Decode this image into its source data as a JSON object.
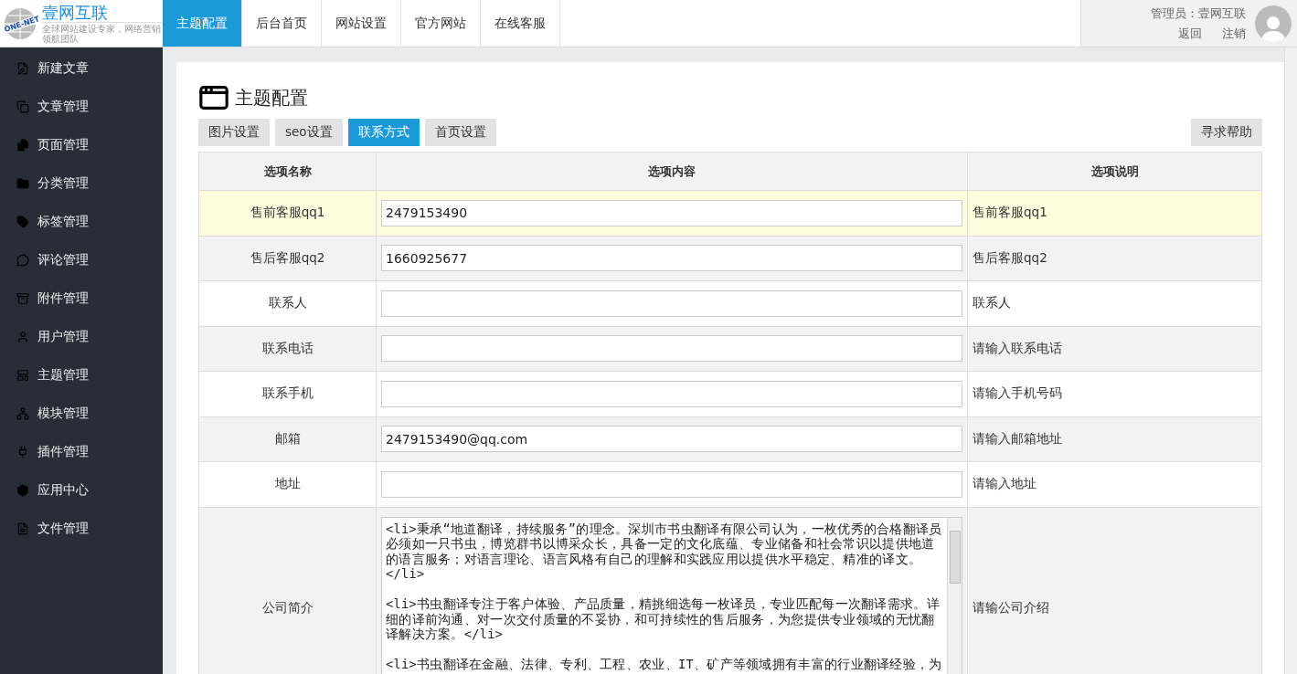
{
  "logo": {
    "name": "壹网互联",
    "tagline": "全球网站建设专家，网络营销领航团队",
    "globe_text": "ONE-NET"
  },
  "top_nav": [
    {
      "label": "主题配置",
      "selected": true
    },
    {
      "label": "后台首页",
      "selected": false
    },
    {
      "label": "网站设置",
      "selected": false
    },
    {
      "label": "官方网站",
      "selected": false
    },
    {
      "label": "在线客服",
      "selected": false
    }
  ],
  "admin": {
    "label": "管理员：壹网互联",
    "links": [
      "返回",
      "注销"
    ]
  },
  "sidebar": {
    "items": [
      {
        "label": "新建文章",
        "kind": "edit"
      },
      {
        "label": "文章管理",
        "kind": "copy"
      },
      {
        "label": "页面管理",
        "kind": "files"
      },
      {
        "label": "分类管理",
        "kind": "folder"
      },
      {
        "label": "标签管理",
        "kind": "tag"
      },
      {
        "label": "评论管理",
        "kind": "comment"
      },
      {
        "label": "附件管理",
        "kind": "box"
      },
      {
        "label": "用户管理",
        "kind": "user"
      },
      {
        "label": "主题管理",
        "kind": "layout"
      },
      {
        "label": "模块管理",
        "kind": "tree"
      },
      {
        "label": "插件管理",
        "kind": "plug"
      },
      {
        "label": "应用中心",
        "kind": "cube"
      },
      {
        "label": "文件管理",
        "kind": "file"
      }
    ]
  },
  "page": {
    "title": "主题配置",
    "tabs": [
      {
        "label": "图片设置",
        "selected": false
      },
      {
        "label": "seo设置",
        "selected": false
      },
      {
        "label": "联系方式",
        "selected": true
      },
      {
        "label": "首页设置",
        "selected": false
      }
    ],
    "help_button": "寻求帮助",
    "table": {
      "columns": [
        "选项名称",
        "选项内容",
        "选项说明"
      ],
      "rows": [
        {
          "name": "售前客服qq1",
          "kind": "input",
          "value": "2479153490",
          "description": "售前客服qq1",
          "highlighted": true
        },
        {
          "name": "售后客服qq2",
          "kind": "input",
          "value": "1660925677",
          "description": "售后客服qq2",
          "highlighted": false
        },
        {
          "name": "联系人",
          "kind": "input",
          "description": "联系人",
          "highlighted": false
        },
        {
          "name": "联系电话",
          "kind": "input",
          "description": "请输入联系电话",
          "highlighted": false
        },
        {
          "name": "联系手机",
          "kind": "input",
          "description": "请输入手机号码",
          "highlighted": false
        },
        {
          "name": "邮箱",
          "kind": "input",
          "value": "2479153490@qq.com",
          "description": "请输入邮箱地址",
          "highlighted": false
        },
        {
          "name": "地址",
          "kind": "input",
          "description": "请输入地址",
          "highlighted": false
        },
        {
          "name": "公司简介",
          "kind": "textarea",
          "value": "<li>秉承“地道翻译，持续服务”的理念。深圳市书虫翻译有限公司认为，一枚优秀的合格翻译员必须如一只书虫，博览群书以博采众长，具备一定的文化底蕴、专业储备和社会常识以提供地道的语言服务；对语言理论、语言风格有自己的理解和实践应用以提供水平稳定、精准的译文。</li>\n\n<li>书虫翻译专注于客户体验、产品质量，精挑细选每一枚译员，专业匹配每一次翻译需求。详细的译前沟通、对一次交付质量的不妥协，和可持续性的售后服务，为您提供专业领域的无忧翻译解决方案。</li>\n\n<li>书虫翻译在金融、法律、专利、工程、农业、IT、矿产等领域拥有丰富的行业翻译经验，为",
          "description": "请输公司介绍",
          "highlighted": false
        }
      ]
    }
  }
}
